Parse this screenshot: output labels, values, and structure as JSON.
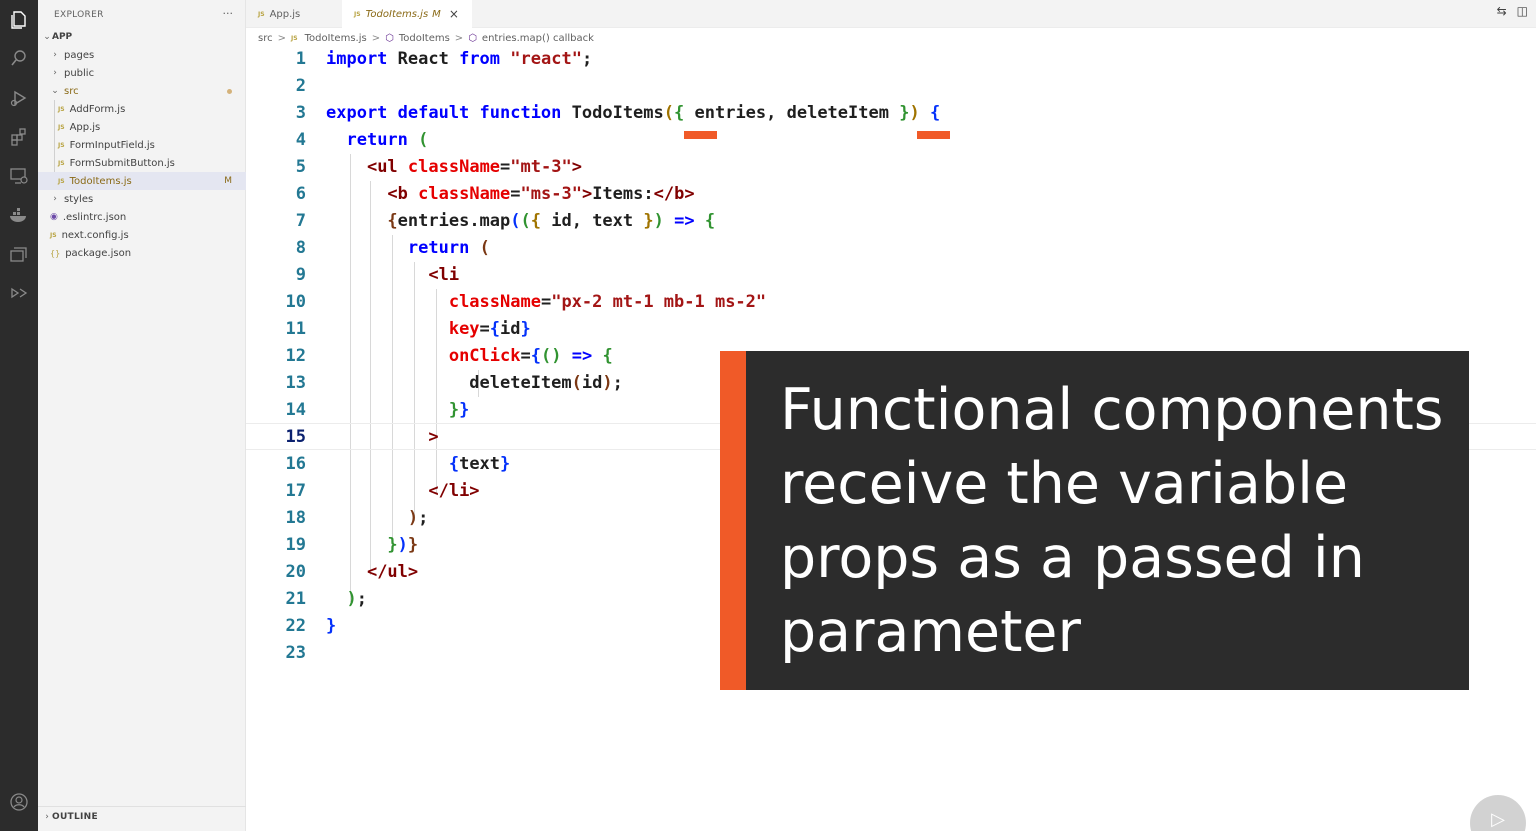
{
  "activity_bar": {
    "icons": [
      "files-icon",
      "search-icon",
      "run-debug-icon",
      "extensions-icon",
      "remote-explorer-icon",
      "docker-icon",
      "stack-icon",
      "live-share-icon",
      "account-icon"
    ]
  },
  "sidebar": {
    "title": "EXPLORER",
    "more": "···",
    "root": "APP",
    "items": [
      {
        "label": "pages",
        "kind": "folder"
      },
      {
        "label": "public",
        "kind": "folder"
      },
      {
        "label": "src",
        "kind": "folder-open"
      },
      {
        "label": "AddForm.js",
        "kind": "js"
      },
      {
        "label": "App.js",
        "kind": "js"
      },
      {
        "label": "FormInputField.js",
        "kind": "js"
      },
      {
        "label": "FormSubmitButton.js",
        "kind": "js"
      },
      {
        "label": "TodoItems.js",
        "kind": "js",
        "status": "M"
      },
      {
        "label": "styles",
        "kind": "folder"
      },
      {
        "label": ".eslintrc.json",
        "kind": "eslint"
      },
      {
        "label": "next.config.js",
        "kind": "js"
      },
      {
        "label": "package.json",
        "kind": "json"
      }
    ],
    "outline": "OUTLINE"
  },
  "tabs": [
    {
      "label": "App.js",
      "icon": "JS"
    },
    {
      "label": "TodoItems.js",
      "icon": "JS",
      "status": "M",
      "close": "×"
    }
  ],
  "breadcrumb": {
    "segments": [
      "src",
      "TodoItems.js",
      "TodoItems",
      "entries.map() callback"
    ],
    "separator": ">"
  },
  "editor": {
    "line_numbers": [
      "1",
      "2",
      "3",
      "4",
      "5",
      "6",
      "7",
      "8",
      "9",
      "10",
      "11",
      "12",
      "13",
      "14",
      "15",
      "16",
      "17",
      "18",
      "19",
      "20",
      "21",
      "22",
      "23"
    ],
    "current_line": "15"
  },
  "overlay": {
    "text": "Functional components receive the variable props as a passed in parameter",
    "accent_color": "#f05a28",
    "background": "#2c2c2c"
  },
  "play_button": {
    "icon": "play-icon",
    "glyph": "▷"
  }
}
